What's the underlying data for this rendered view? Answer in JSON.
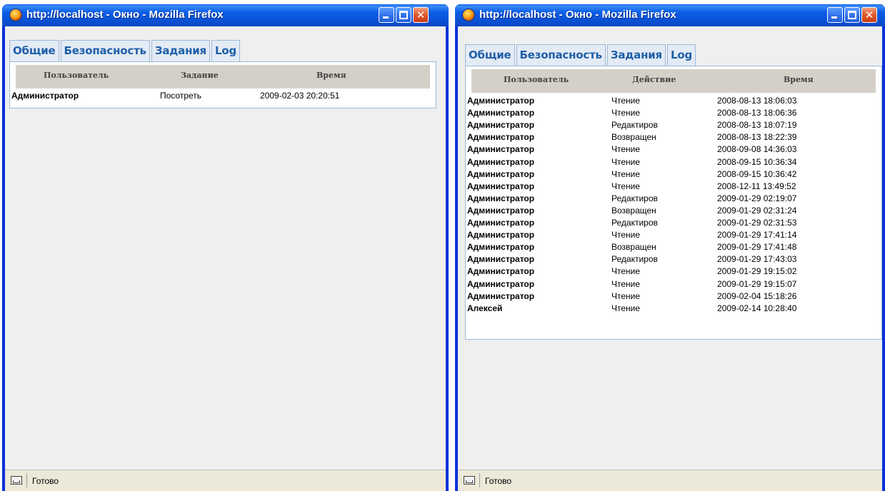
{
  "left_window": {
    "title": "http://localhost - Окно - Mozilla Firefox",
    "tabs": [
      "Общие",
      "Безопасность",
      "Задания",
      "Log"
    ],
    "columns": [
      "Пользователь",
      "Задание",
      "Время"
    ],
    "rows": [
      [
        "Администратор",
        "Посотреть",
        "2009-02-03 20:20:51"
      ]
    ],
    "status": "Готово"
  },
  "right_window": {
    "title": "http://localhost - Окно - Mozilla Firefox",
    "tabs": [
      "Общие",
      "Безопасность",
      "Задания",
      "Log"
    ],
    "columns": [
      "Пользователь",
      "Действие",
      "Время"
    ],
    "rows": [
      [
        "Администратор",
        "Чтение",
        "2008-08-13 18:06:03"
      ],
      [
        "Администратор",
        "Чтение",
        "2008-08-13 18:06:36"
      ],
      [
        "Администратор",
        "Редактиров",
        "2008-08-13 18:07:19"
      ],
      [
        "Администратор",
        "Возвращен",
        "2008-08-13 18:22:39"
      ],
      [
        "Администратор",
        "Чтение",
        "2008-09-08 14:36:03"
      ],
      [
        "Администратор",
        "Чтение",
        "2008-09-15 10:36:34"
      ],
      [
        "Администратор",
        "Чтение",
        "2008-09-15 10:36:42"
      ],
      [
        "Администратор",
        "Чтение",
        "2008-12-11 13:49:52"
      ],
      [
        "Администратор",
        "Редактиров",
        "2009-01-29 02:19:07"
      ],
      [
        "Администратор",
        "Возвращен",
        "2009-01-29 02:31:24"
      ],
      [
        "Администратор",
        "Редактиров",
        "2009-01-29 02:31:53"
      ],
      [
        "Администратор",
        "Чтение",
        "2009-01-29 17:41:14"
      ],
      [
        "Администратор",
        "Возвращен",
        "2009-01-29 17:41:48"
      ],
      [
        "Администратор",
        "Редактиров",
        "2009-01-29 17:43:03"
      ],
      [
        "Администратор",
        "Чтение",
        "2009-01-29 19:15:02"
      ],
      [
        "Администратор",
        "Чтение",
        "2009-01-29 19:15:07"
      ],
      [
        "Администратор",
        "Чтение",
        "2009-02-04 15:18:26"
      ],
      [
        "Алексей",
        "Чтение",
        "2009-02-14 10:28:40"
      ]
    ],
    "status": "Готово"
  },
  "colors": {
    "titlebar": "#0a5ce8",
    "frame": "#0831d9",
    "tab_text": "#1f5fa8",
    "tab_bg": "#e3ebf5",
    "header_bg": "#d4d0c8",
    "client_bg": "#efefef"
  },
  "icons": [
    "firefox-icon",
    "minimize-icon",
    "maximize-icon",
    "close-icon",
    "status-page-icon"
  ]
}
